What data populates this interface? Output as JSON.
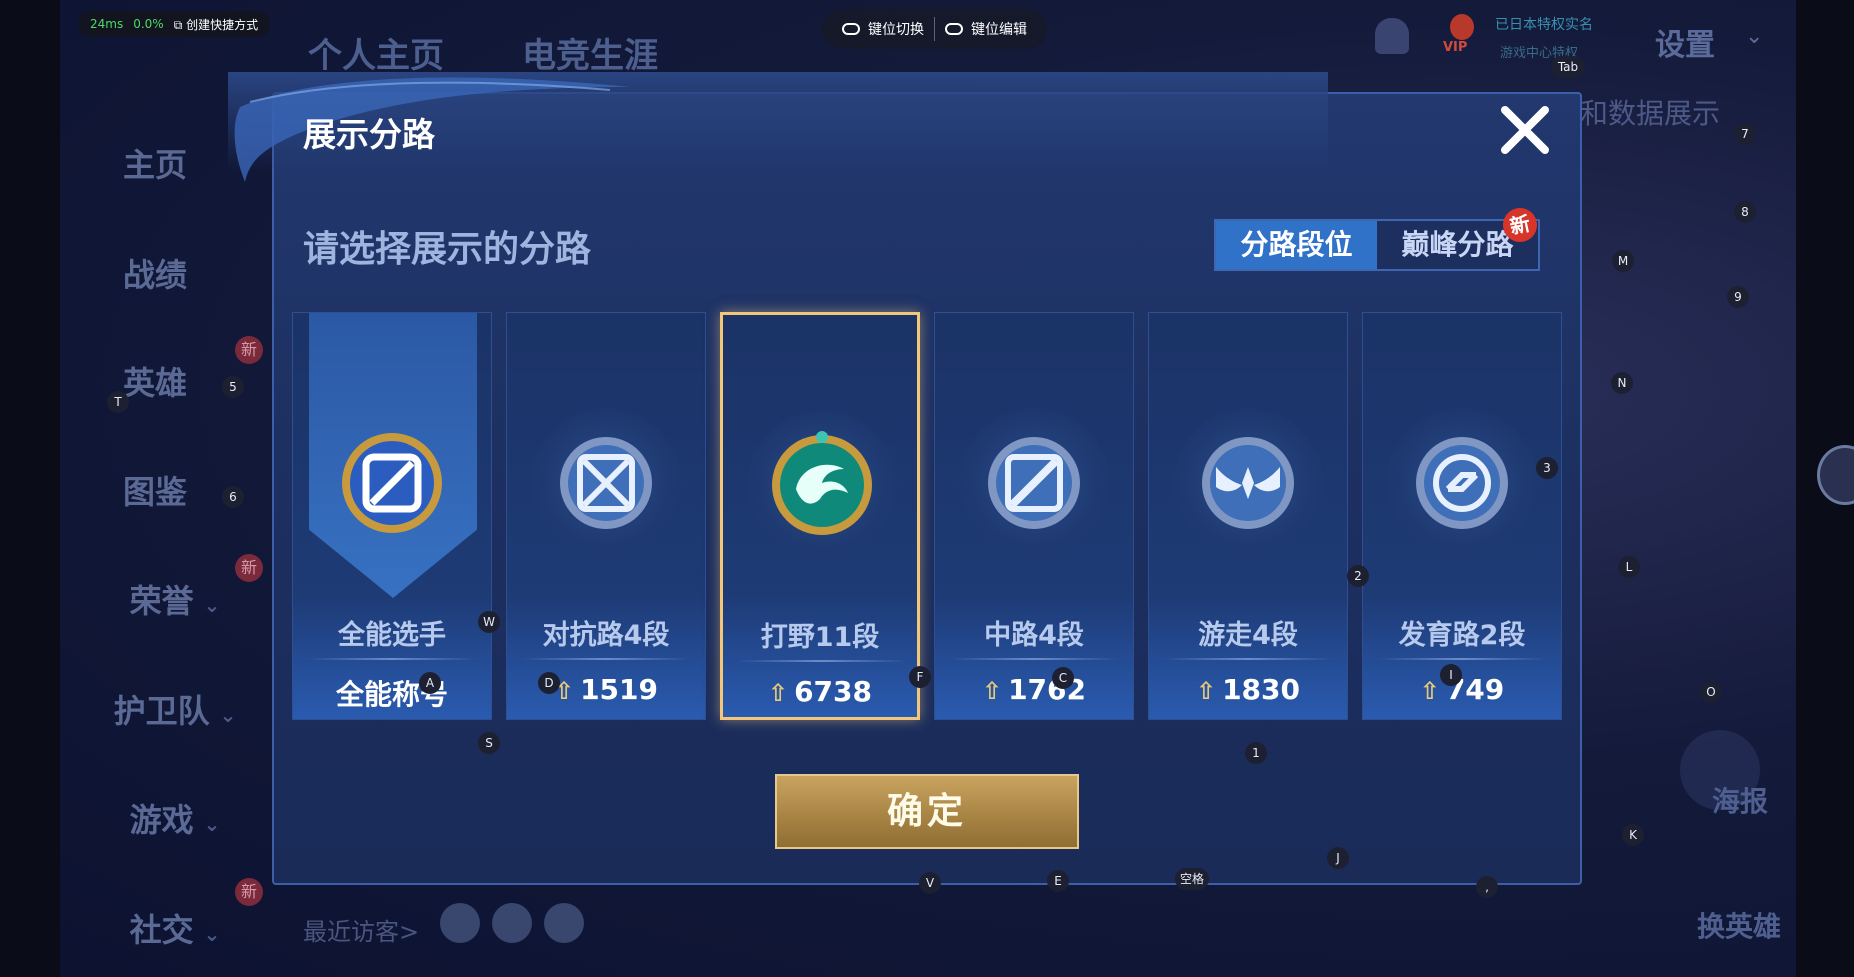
{
  "overlay": {
    "latency": "24ms",
    "cpu": "0.0%",
    "shortcut_label": "创建快捷方式",
    "keybar": {
      "switch_label": "键位切换",
      "edit_label": "键位编辑"
    }
  },
  "background": {
    "nav_tabs": [
      "个人主页",
      "电竞生涯"
    ],
    "settings_label": "设置",
    "vip_label": "VIP",
    "vip_line1": "已日本特权实名",
    "vip_line2": "游戏中心特权",
    "data_show": "和数据展示",
    "sidebar": [
      {
        "label": "主页",
        "has_chevron": false
      },
      {
        "label": "战绩",
        "has_chevron": false
      },
      {
        "label": "英雄",
        "has_chevron": false
      },
      {
        "label": "图鉴",
        "has_chevron": false
      },
      {
        "label": "荣誉",
        "has_chevron": true
      },
      {
        "label": "护卫队",
        "has_chevron": true
      },
      {
        "label": "游戏",
        "has_chevron": true
      },
      {
        "label": "社交",
        "has_chevron": true
      }
    ],
    "new_badge": "新",
    "recent_visitors": "最近访客>",
    "poster_label": "海报",
    "change_hero_label": "换英雄"
  },
  "modal": {
    "title": "展示分路",
    "subtitle": "请选择展示的分路",
    "toggle": {
      "active": "分路段位",
      "inactive": "巅峰分路",
      "new_badge": "新"
    },
    "cards": [
      {
        "rank": "全能选手",
        "score": "全能称号",
        "has_arrow": false,
        "selected": false,
        "icon": "all-round-emblem"
      },
      {
        "rank": "对抗路4段",
        "score": "1519",
        "has_arrow": true,
        "selected": false,
        "icon": "clash-lane-emblem"
      },
      {
        "rank": "打野11段",
        "score": "6738",
        "has_arrow": true,
        "selected": true,
        "icon": "jungle-dragon-emblem"
      },
      {
        "rank": "中路4段",
        "score": "1762",
        "has_arrow": true,
        "selected": false,
        "icon": "mid-lane-emblem"
      },
      {
        "rank": "游走4段",
        "score": "1830",
        "has_arrow": true,
        "selected": false,
        "icon": "roam-wings-emblem"
      },
      {
        "rank": "发育路2段",
        "score": "749",
        "has_arrow": true,
        "selected": false,
        "icon": "farm-lane-emblem"
      }
    ],
    "arrow_symbol": "⇧",
    "confirm_label": "确定"
  },
  "key_hints": [
    {
      "key": "Tab"
    },
    {
      "key": "7"
    },
    {
      "key": "8"
    },
    {
      "key": "M"
    },
    {
      "key": "9"
    },
    {
      "key": "N"
    },
    {
      "key": "3"
    },
    {
      "key": "L"
    },
    {
      "key": "2"
    },
    {
      "key": "O"
    },
    {
      "key": "K"
    },
    {
      "key": "J"
    },
    {
      "key": "1"
    },
    {
      "key": "I"
    },
    {
      "key": "C"
    },
    {
      "key": "F"
    },
    {
      "key": "D"
    },
    {
      "key": "A"
    },
    {
      "key": "W"
    },
    {
      "key": "S"
    },
    {
      "key": "V"
    },
    {
      "key": "E"
    },
    {
      "key": "空格"
    },
    {
      "key": ","
    },
    {
      "key": "T"
    },
    {
      "key": "5"
    },
    {
      "key": "6"
    }
  ]
}
